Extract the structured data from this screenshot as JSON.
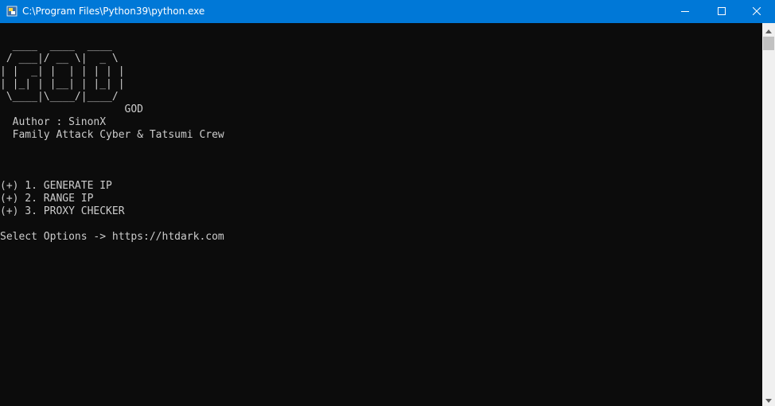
{
  "window": {
    "title": "C:\\Program Files\\Python39\\python.exe",
    "icon": "python-icon",
    "controls": [
      "minimize-icon",
      "maximize-icon",
      "close-icon"
    ]
  },
  "console": {
    "lines": [
      "  ____  ____  ____",
      " / ___|/ __ \\|  _ \\",
      "| |  _| |  | | | | |",
      "| |_| | |__| | |_| |",
      " \\____|\\____/|____/",
      "                    GOD",
      "  Author : SinonX",
      "  Family Attack Cyber & Tatsumi Crew",
      "",
      "",
      "",
      "(+) 1. GENERATE IP",
      "(+) 2. RANGE IP",
      "(+) 3. PROXY CHECKER",
      "",
      "Select Options -> https://htdark.com"
    ]
  },
  "colors": {
    "titlebar": "#0078d7",
    "console_bg": "#0c0c0c",
    "console_fg": "#cccccc",
    "scrollbar_bg": "#f0f0f0",
    "scrollbar_thumb": "#c1c1c1"
  }
}
